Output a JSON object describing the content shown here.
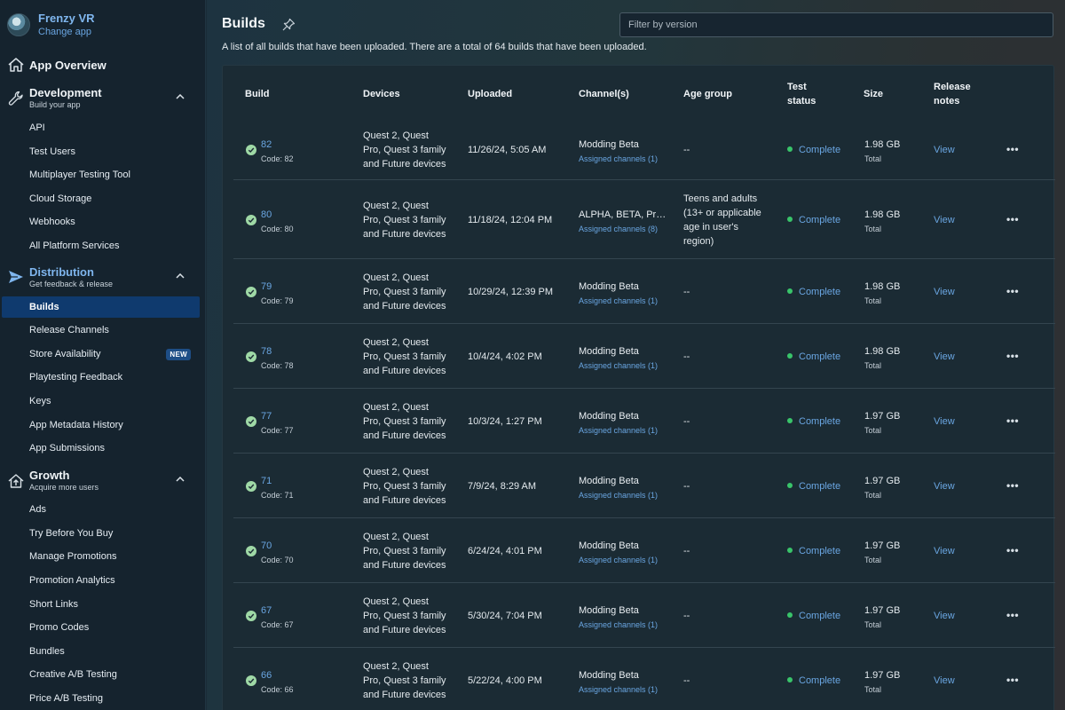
{
  "app": {
    "name": "Frenzy VR",
    "change_label": "Change app"
  },
  "nav": {
    "overview": "App Overview",
    "development": {
      "label": "Development",
      "sub": "Build your app",
      "items": [
        "API",
        "Test Users",
        "Multiplayer Testing Tool",
        "Cloud Storage",
        "Webhooks",
        "All Platform Services"
      ]
    },
    "distribution": {
      "label": "Distribution",
      "sub": "Get feedback & release",
      "items": [
        "Builds",
        "Release Channels",
        "Store Availability",
        "Playtesting Feedback",
        "Keys",
        "App Metadata History",
        "App Submissions"
      ],
      "new_badge": "NEW"
    },
    "growth": {
      "label": "Growth",
      "sub": "Acquire more users",
      "items": [
        "Ads",
        "Try Before You Buy",
        "Manage Promotions",
        "Promotion Analytics",
        "Short Links",
        "Promo Codes",
        "Bundles",
        "Creative A/B Testing",
        "Price A/B Testing"
      ]
    }
  },
  "page": {
    "title": "Builds",
    "filter_placeholder": "Filter by version",
    "description": "A list of all builds that have been uploaded. There are a total of 64 builds that have been uploaded."
  },
  "table": {
    "headers": {
      "build": "Build",
      "devices": "Devices",
      "uploaded": "Uploaded",
      "channels": "Channel(s)",
      "age": "Age group",
      "test_1": "Test",
      "test_2": "status",
      "size": "Size",
      "notes_1": "Release",
      "notes_2": "notes"
    },
    "rows": [
      {
        "build": "82",
        "code": "Code: 82",
        "dev1": "Quest 2, Quest",
        "dev2": "Pro, Quest 3 family",
        "dev3": "and Future devices",
        "uploaded": "11/26/24, 5:05 AM",
        "channel": "Modding Beta",
        "assigned": "Assigned channels (1)",
        "age1": "--",
        "age2": "",
        "age3": "",
        "age4": "",
        "status": "Complete",
        "size": "1.98 GB",
        "total": "Total",
        "view": "View",
        "more": "•••"
      },
      {
        "build": "80",
        "code": "Code: 80",
        "dev1": "Quest 2, Quest",
        "dev2": "Pro, Quest 3 family",
        "dev3": "and Future devices",
        "uploaded": "11/18/24, 12:04 PM",
        "channel": "ALPHA, BETA, Pro...",
        "assigned": "Assigned channels (8)",
        "age1": "Teens and adults",
        "age2": "(13+ or applicable",
        "age3": "age in user's",
        "age4": "region)",
        "status": "Complete",
        "size": "1.98 GB",
        "total": "Total",
        "view": "View",
        "more": "•••"
      },
      {
        "build": "79",
        "code": "Code: 79",
        "dev1": "Quest 2, Quest",
        "dev2": "Pro, Quest 3 family",
        "dev3": "and Future devices",
        "uploaded": "10/29/24, 12:39 PM",
        "channel": "Modding Beta",
        "assigned": "Assigned channels (1)",
        "age1": "--",
        "age2": "",
        "age3": "",
        "age4": "",
        "status": "Complete",
        "size": "1.98 GB",
        "total": "Total",
        "view": "View",
        "more": "•••"
      },
      {
        "build": "78",
        "code": "Code: 78",
        "dev1": "Quest 2, Quest",
        "dev2": "Pro, Quest 3 family",
        "dev3": "and Future devices",
        "uploaded": "10/4/24, 4:02 PM",
        "channel": "Modding Beta",
        "assigned": "Assigned channels (1)",
        "age1": "--",
        "age2": "",
        "age3": "",
        "age4": "",
        "status": "Complete",
        "size": "1.98 GB",
        "total": "Total",
        "view": "View",
        "more": "•••"
      },
      {
        "build": "77",
        "code": "Code: 77",
        "dev1": "Quest 2, Quest",
        "dev2": "Pro, Quest 3 family",
        "dev3": "and Future devices",
        "uploaded": "10/3/24, 1:27 PM",
        "channel": "Modding Beta",
        "assigned": "Assigned channels (1)",
        "age1": "--",
        "age2": "",
        "age3": "",
        "age4": "",
        "status": "Complete",
        "size": "1.97 GB",
        "total": "Total",
        "view": "View",
        "more": "•••"
      },
      {
        "build": "71",
        "code": "Code: 71",
        "dev1": "Quest 2, Quest",
        "dev2": "Pro, Quest 3 family",
        "dev3": "and Future devices",
        "uploaded": "7/9/24, 8:29 AM",
        "channel": "Modding Beta",
        "assigned": "Assigned channels (1)",
        "age1": "--",
        "age2": "",
        "age3": "",
        "age4": "",
        "status": "Complete",
        "size": "1.97 GB",
        "total": "Total",
        "view": "View",
        "more": "•••"
      },
      {
        "build": "70",
        "code": "Code: 70",
        "dev1": "Quest 2, Quest",
        "dev2": "Pro, Quest 3 family",
        "dev3": "and Future devices",
        "uploaded": "6/24/24, 4:01 PM",
        "channel": "Modding Beta",
        "assigned": "Assigned channels (1)",
        "age1": "--",
        "age2": "",
        "age3": "",
        "age4": "",
        "status": "Complete",
        "size": "1.97 GB",
        "total": "Total",
        "view": "View",
        "more": "•••"
      },
      {
        "build": "67",
        "code": "Code: 67",
        "dev1": "Quest 2, Quest",
        "dev2": "Pro, Quest 3 family",
        "dev3": "and Future devices",
        "uploaded": "5/30/24, 7:04 PM",
        "channel": "Modding Beta",
        "assigned": "Assigned channels (1)",
        "age1": "--",
        "age2": "",
        "age3": "",
        "age4": "",
        "status": "Complete",
        "size": "1.97 GB",
        "total": "Total",
        "view": "View",
        "more": "•••"
      },
      {
        "build": "66",
        "code": "Code: 66",
        "dev1": "Quest 2, Quest",
        "dev2": "Pro, Quest 3 family",
        "dev3": "and Future devices",
        "uploaded": "5/22/24, 4:00 PM",
        "channel": "Modding Beta",
        "assigned": "Assigned channels (1)",
        "age1": "--",
        "age2": "",
        "age3": "",
        "age4": "",
        "status": "Complete",
        "size": "1.97 GB",
        "total": "Total",
        "view": "View",
        "more": "•••"
      }
    ]
  },
  "colors": {
    "accent": "#6aa6e2",
    "active_nav": "#0f3a6e",
    "status_dot": "#39c46a",
    "check": "#9fd9a6"
  }
}
